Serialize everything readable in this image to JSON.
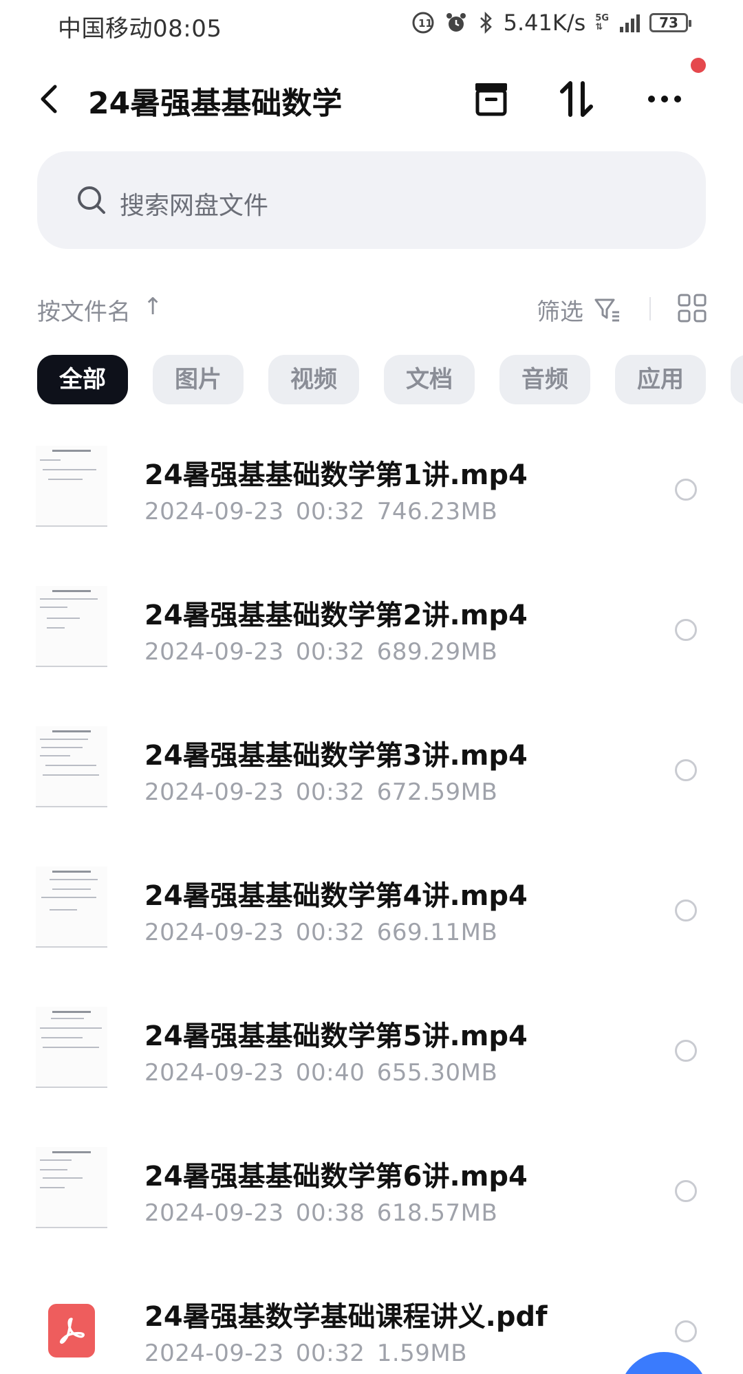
{
  "status_bar": {
    "carrier": "中国移动",
    "time": "08:05",
    "net_speed": "5.41K/s",
    "network_type": "5G",
    "battery": "73"
  },
  "header": {
    "title": "24暑强基基础数学",
    "back_icon": "chevron-left-icon",
    "actions": [
      "archive-box-icon",
      "transfer-arrows-icon",
      "more-icon"
    ]
  },
  "search": {
    "placeholder": "搜索网盘文件"
  },
  "sort": {
    "label": "按文件名",
    "arrow": "↑",
    "filter_label": "筛选"
  },
  "categories": [
    {
      "label": "全部",
      "active": true
    },
    {
      "label": "图片",
      "active": false
    },
    {
      "label": "视频",
      "active": false
    },
    {
      "label": "文档",
      "active": false
    },
    {
      "label": "音频",
      "active": false
    },
    {
      "label": "应用",
      "active": false
    }
  ],
  "files": [
    {
      "name": "24暑强基基础数学第1讲.mp4",
      "date": "2024-09-23",
      "time": "00:32",
      "size": "746.23MB",
      "type": "video"
    },
    {
      "name": "24暑强基基础数学第2讲.mp4",
      "date": "2024-09-23",
      "time": "00:32",
      "size": "689.29MB",
      "type": "video"
    },
    {
      "name": "24暑强基基础数学第3讲.mp4",
      "date": "2024-09-23",
      "time": "00:32",
      "size": "672.59MB",
      "type": "video"
    },
    {
      "name": "24暑强基基础数学第4讲.mp4",
      "date": "2024-09-23",
      "time": "00:32",
      "size": "669.11MB",
      "type": "video"
    },
    {
      "name": "24暑强基基础数学第5讲.mp4",
      "date": "2024-09-23",
      "time": "00:40",
      "size": "655.30MB",
      "type": "video"
    },
    {
      "name": "24暑强基基础数学第6讲.mp4",
      "date": "2024-09-23",
      "time": "00:38",
      "size": "618.57MB",
      "type": "video"
    },
    {
      "name": "24暑强基数学基础课程讲义.pdf",
      "date": "2024-09-23",
      "time": "00:32",
      "size": "1.59MB",
      "type": "pdf"
    }
  ],
  "colors": {
    "active_chip": "#0e111a",
    "chip_bg": "#eceef2",
    "search_bg": "#f1f2f6",
    "notification": "#e5484d",
    "pdf": "#ee5d5d",
    "fab": "#3a7bfd"
  }
}
